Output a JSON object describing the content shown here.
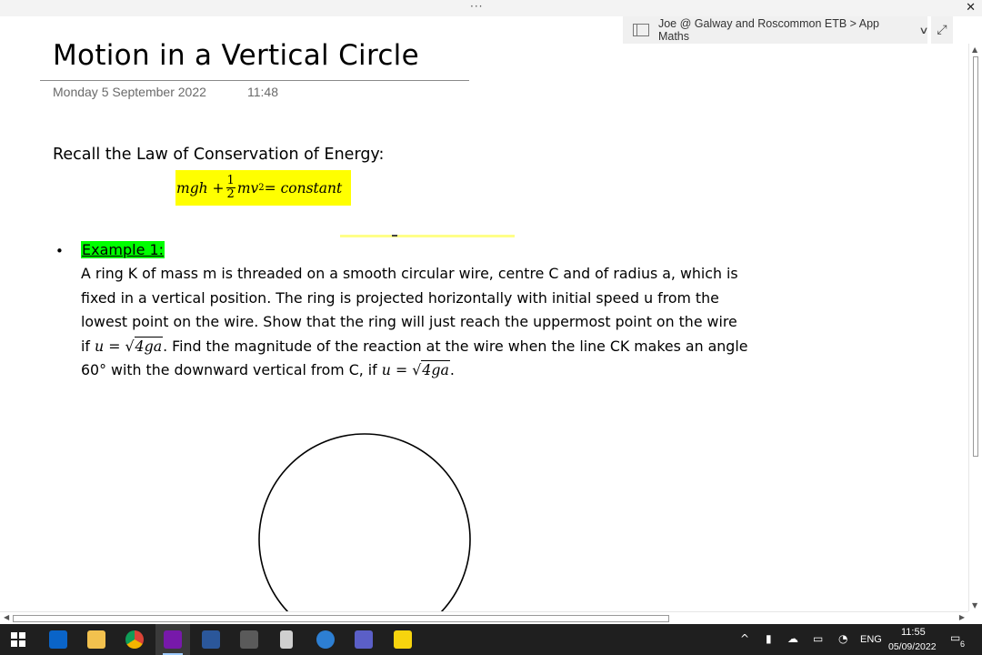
{
  "window": {
    "dots": "···",
    "close": "✕"
  },
  "notebook_path": "Joe @ Galway and Roscommon ETB > App Maths",
  "page": {
    "title": "Motion in a Vertical Circle",
    "date": "Monday 5 September 2022",
    "time": "11:48"
  },
  "content": {
    "recall": "Recall the Law of Conservation of Energy:",
    "formula": {
      "left": "mgh + ",
      "frac_num": "1",
      "frac_den": "2",
      "mid": "mv",
      "sup": "2",
      "right": " = constant"
    },
    "bullet": "•",
    "example_label": "Example 1:",
    "problem": {
      "line1": "A ring K of mass m is threaded on a smooth circular wire, centre C and of radius a, which is",
      "line2": "fixed in a vertical position. The ring is projected horizontally with initial speed u from the",
      "line3": "lowest point on the wire. Show that the ring will just reach the uppermost point on the wire",
      "line4_pre": "if ",
      "line4_math_var": "u",
      "line4_math_eq": " = ",
      "line4_math_rad": "4ga",
      "line4_post": ". Find the magnitude of the reaction at the wire when the line CK makes an angle",
      "line5_pre": "60° with the downward vertical from C, if ",
      "line5_math_var": "u",
      "line5_math_eq": " = ",
      "line5_math_rad": "4ga",
      "line5_post": "."
    }
  },
  "taskbar": {
    "apps": [
      "windows-start",
      "outlook",
      "file-explorer",
      "chrome",
      "onenote",
      "word",
      "calculator",
      "phone",
      "edge-legacy",
      "teams",
      "sticky-notes"
    ],
    "tray": {
      "language": "ENG",
      "time": "11:55",
      "date": "05/09/2022",
      "notifications": "6"
    }
  },
  "colors": {
    "formula_highlight": "#ffff00",
    "example_highlight": "#00ff00",
    "taskbar": "#1f1f1f"
  }
}
